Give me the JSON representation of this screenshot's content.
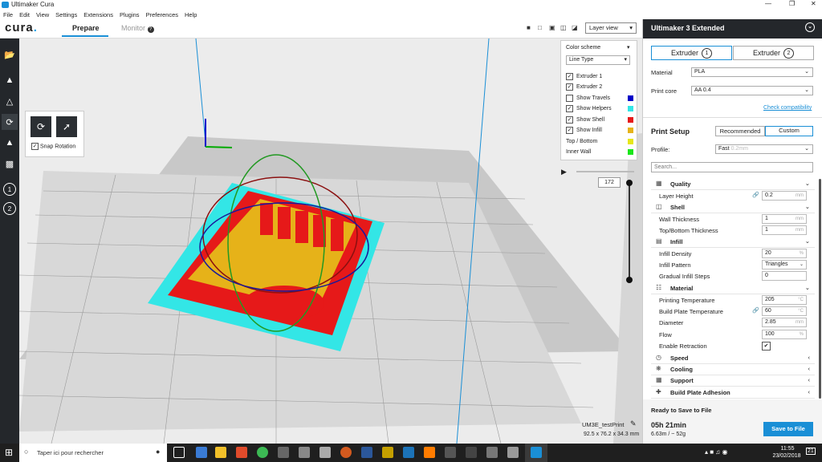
{
  "window": {
    "title": "Ultimaker Cura"
  },
  "menu": [
    "File",
    "Edit",
    "View",
    "Settings",
    "Extensions",
    "Plugins",
    "Preferences",
    "Help"
  ],
  "header": {
    "brand": "cura",
    "brand_dot": ".",
    "tabs": [
      {
        "label": "Prepare"
      },
      {
        "label": "Monitor"
      }
    ]
  },
  "rotate_panel": {
    "snap_label": "Snap Rotation"
  },
  "viewport": {
    "view_mode": "Layer view",
    "object_name": "UM3E_testPrint",
    "dimensions": "92.5 x 76.2 x 34.3 mm",
    "layer_number": "172"
  },
  "color_panel": {
    "scheme_label": "Color scheme",
    "scheme_value": "Line Type",
    "rows": [
      {
        "label": "Extruder 1",
        "checked": true,
        "color": ""
      },
      {
        "label": "Extruder 2",
        "checked": true,
        "color": ""
      },
      {
        "label": "Show Travels",
        "checked": false,
        "color": "#0000c8"
      },
      {
        "label": "Show Helpers",
        "checked": true,
        "color": "#33e6e6"
      },
      {
        "label": "Show Shell",
        "checked": true,
        "color": "#e61919"
      },
      {
        "label": "Show Infill",
        "checked": true,
        "color": "#e6b319"
      },
      {
        "label": "Top / Bottom",
        "checked": null,
        "color": "#e6e619"
      },
      {
        "label": "Inner Wall",
        "checked": null,
        "color": "#19e619"
      }
    ]
  },
  "right_panel": {
    "printer": "Ultimaker 3 Extended",
    "extruders": [
      {
        "label": "Extruder",
        "num": "1"
      },
      {
        "label": "Extruder",
        "num": "2"
      }
    ],
    "material_label": "Material",
    "material_value": "PLA",
    "printcore_label": "Print core",
    "printcore_value": "AA 0.4",
    "compat_link": "Check compatibility",
    "print_setup": "Print Setup",
    "mode_recommended": "Recommended",
    "mode_custom": "Custom",
    "profile_label": "Profile:",
    "profile_value": "Fast",
    "profile_hint": "0.2mm",
    "search_placeholder": "Search...",
    "categories": [
      {
        "name": "Quality",
        "open": true,
        "settings": [
          {
            "name": "Layer Height",
            "value": "0.2",
            "unit": "mm",
            "linked": true
          }
        ]
      },
      {
        "name": "Shell",
        "open": true,
        "settings": [
          {
            "name": "Wall Thickness",
            "value": "1",
            "unit": "mm"
          },
          {
            "name": "Top/Bottom Thickness",
            "value": "1",
            "unit": "mm"
          }
        ]
      },
      {
        "name": "Infill",
        "open": true,
        "settings": [
          {
            "name": "Infill Density",
            "value": "20",
            "unit": "%"
          },
          {
            "name": "Infill Pattern",
            "value": "Triangles",
            "unit": "",
            "dropdown": true
          },
          {
            "name": "Gradual Infill Steps",
            "value": "0",
            "unit": ""
          }
        ]
      },
      {
        "name": "Material",
        "open": true,
        "settings": [
          {
            "name": "Printing Temperature",
            "value": "205",
            "unit": "°C"
          },
          {
            "name": "Build Plate Temperature",
            "value": "60",
            "unit": "°C",
            "linked": true
          },
          {
            "name": "Diameter",
            "value": "2.85",
            "unit": "mm"
          },
          {
            "name": "Flow",
            "value": "100",
            "unit": "%"
          },
          {
            "name": "Enable Retraction",
            "value": "✔",
            "unit": "",
            "checkbox": true
          }
        ]
      },
      {
        "name": "Speed",
        "open": false,
        "settings": []
      },
      {
        "name": "Cooling",
        "open": false,
        "settings": []
      },
      {
        "name": "Support",
        "open": false,
        "settings": []
      },
      {
        "name": "Build Plate Adhesion",
        "open": false,
        "settings": []
      }
    ],
    "status": "Ready to Save to File",
    "print_time": "05h 21min",
    "filament": "6.63m / ~ 52g",
    "save_button": "Save to File"
  },
  "taskbar": {
    "search_placeholder": "Taper ici pour rechercher",
    "time": "11:55",
    "date": "23/02/2018",
    "notif_count": "21"
  }
}
